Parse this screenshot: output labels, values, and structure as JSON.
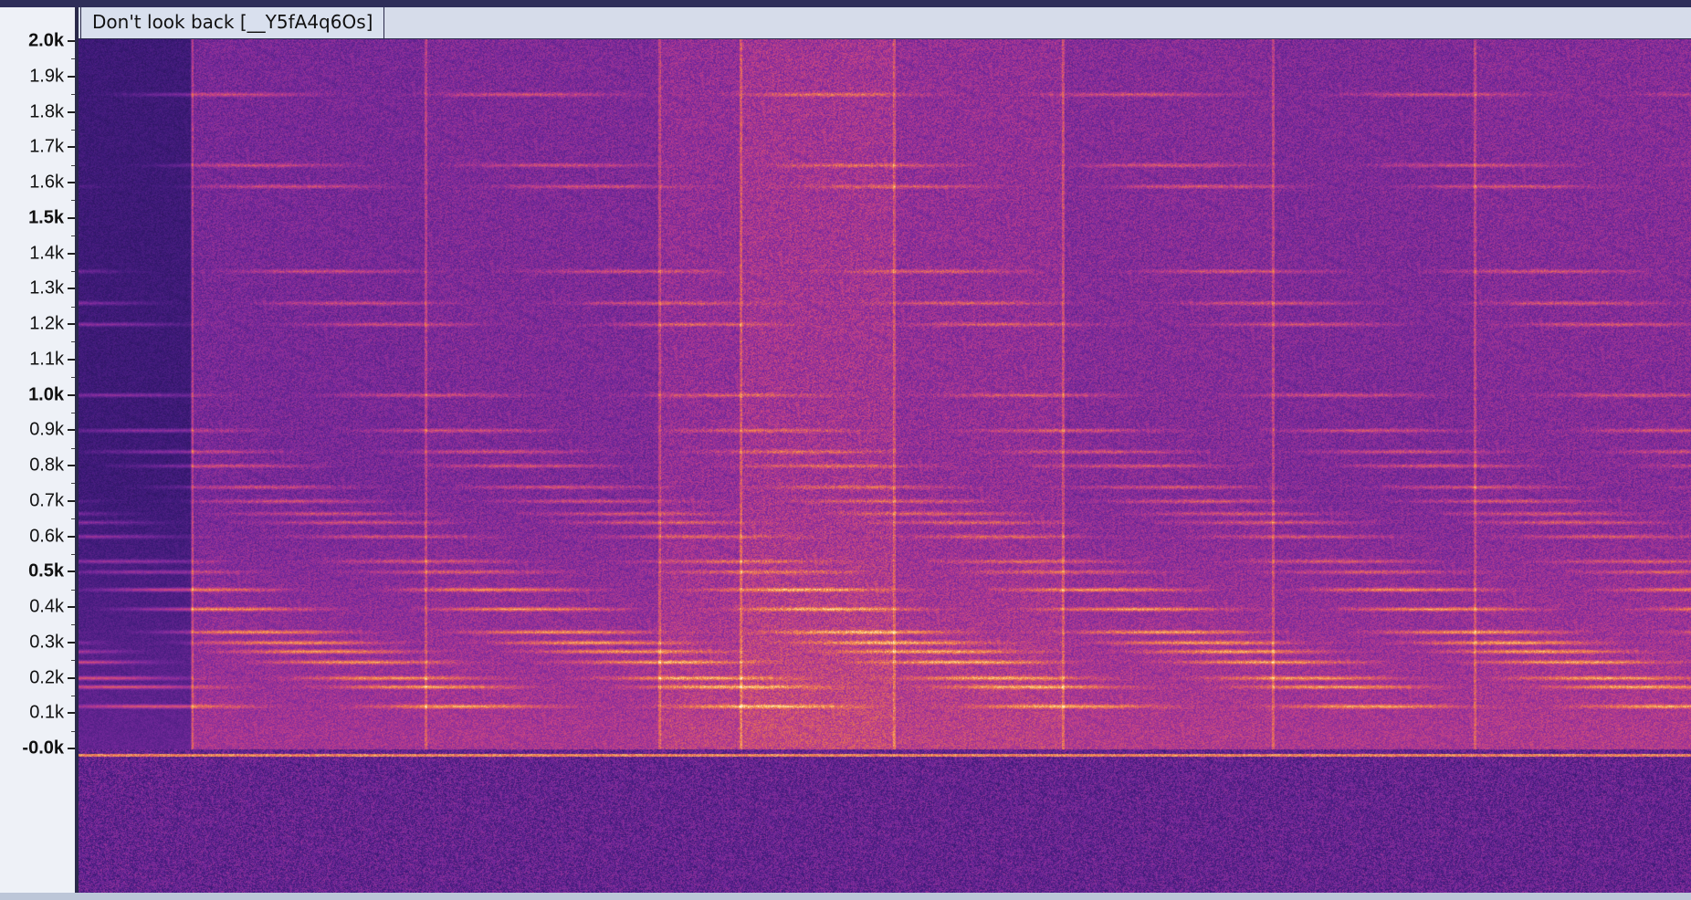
{
  "track": {
    "title": "Don't look back [__Y5fA4q6Os]"
  },
  "ruler": {
    "unit": "Hz",
    "ticks": [
      {
        "label": "2.0k",
        "value": 2000,
        "major": true
      },
      {
        "label": "1.9k",
        "value": 1900,
        "major": false
      },
      {
        "label": "1.8k",
        "value": 1800,
        "major": false
      },
      {
        "label": "1.7k",
        "value": 1700,
        "major": false
      },
      {
        "label": "1.6k",
        "value": 1600,
        "major": false
      },
      {
        "label": "1.5k",
        "value": 1500,
        "major": true
      },
      {
        "label": "1.4k",
        "value": 1400,
        "major": false
      },
      {
        "label": "1.3k",
        "value": 1300,
        "major": false
      },
      {
        "label": "1.2k",
        "value": 1200,
        "major": false
      },
      {
        "label": "1.1k",
        "value": 1100,
        "major": false
      },
      {
        "label": "1.0k",
        "value": 1000,
        "major": true
      },
      {
        "label": "0.9k",
        "value": 900,
        "major": false
      },
      {
        "label": "0.8k",
        "value": 800,
        "major": false
      },
      {
        "label": "0.7k",
        "value": 700,
        "major": false
      },
      {
        "label": "0.6k",
        "value": 600,
        "major": false
      },
      {
        "label": "0.5k",
        "value": 500,
        "major": true
      },
      {
        "label": "0.4k",
        "value": 400,
        "major": false
      },
      {
        "label": "0.3k",
        "value": 300,
        "major": false
      },
      {
        "label": "0.2k",
        "value": 200,
        "major": false
      },
      {
        "label": "0.1k",
        "value": 100,
        "major": false
      },
      {
        "label": "-0.0k",
        "value": 0,
        "major": true
      }
    ],
    "range": [
      0,
      2000
    ]
  },
  "spectrogram": {
    "colormap": [
      "#120a33",
      "#3b1a78",
      "#7a2a9e",
      "#c23f8a",
      "#ef7a4a",
      "#fdd27a",
      "#ffffff"
    ],
    "segment_boundaries_fraction": [
      0.0,
      0.07,
      0.215,
      0.36,
      0.41,
      0.505,
      0.61,
      0.74,
      0.865,
      1.0
    ],
    "harmonic_frequencies_hz": [
      120,
      175,
      200,
      245,
      275,
      300,
      330,
      395,
      450,
      500,
      530,
      600,
      640,
      665,
      700,
      740,
      800,
      840,
      900,
      1000,
      1200,
      1260,
      1350,
      1590,
      1650,
      1850
    ]
  }
}
